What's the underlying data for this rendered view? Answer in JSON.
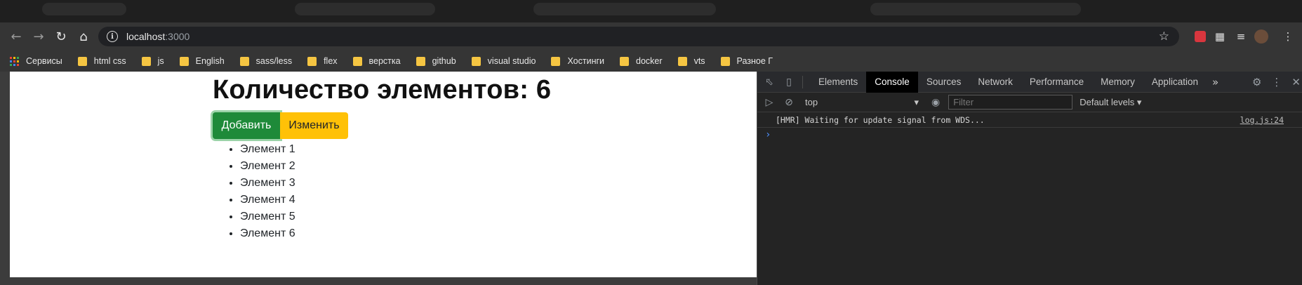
{
  "browser": {
    "url_host": "localhost",
    "url_port": ":3000",
    "bookmarks": [
      {
        "label": "Сервисы",
        "icon": "apps-icon"
      },
      {
        "label": "html css",
        "icon": "folder-icon"
      },
      {
        "label": "js",
        "icon": "folder-icon"
      },
      {
        "label": "English",
        "icon": "folder-icon"
      },
      {
        "label": "sass/less",
        "icon": "folder-icon"
      },
      {
        "label": "flex",
        "icon": "folder-icon"
      },
      {
        "label": "верстка",
        "icon": "folder-icon"
      },
      {
        "label": "github",
        "icon": "folder-icon"
      },
      {
        "label": "visual studio",
        "icon": "folder-icon"
      },
      {
        "label": "Хостинги",
        "icon": "folder-icon"
      },
      {
        "label": "docker",
        "icon": "folder-icon"
      },
      {
        "label": "vts",
        "icon": "folder-icon"
      },
      {
        "label": "Разное Г",
        "icon": "folder-icon"
      }
    ]
  },
  "page": {
    "title": "Количество элементов: 6",
    "add_button": "Добавить",
    "edit_button": "Изменить",
    "items": [
      "Элемент 1",
      "Элемент 2",
      "Элемент 3",
      "Элемент 4",
      "Элемент 5",
      "Элемент 6"
    ]
  },
  "devtools": {
    "tabs": [
      "Elements",
      "Console",
      "Sources",
      "Network",
      "Performance",
      "Memory",
      "Application"
    ],
    "active_tab": "Console",
    "context": "top",
    "filter_placeholder": "Filter",
    "levels": "Default levels",
    "log_message": "[HMR] Waiting for update signal from WDS...",
    "log_source": "log.js:24"
  },
  "colors": {
    "add_button": "#1e8a39",
    "edit_button": "#ffc107",
    "console_prompt": "#4d90fe"
  }
}
